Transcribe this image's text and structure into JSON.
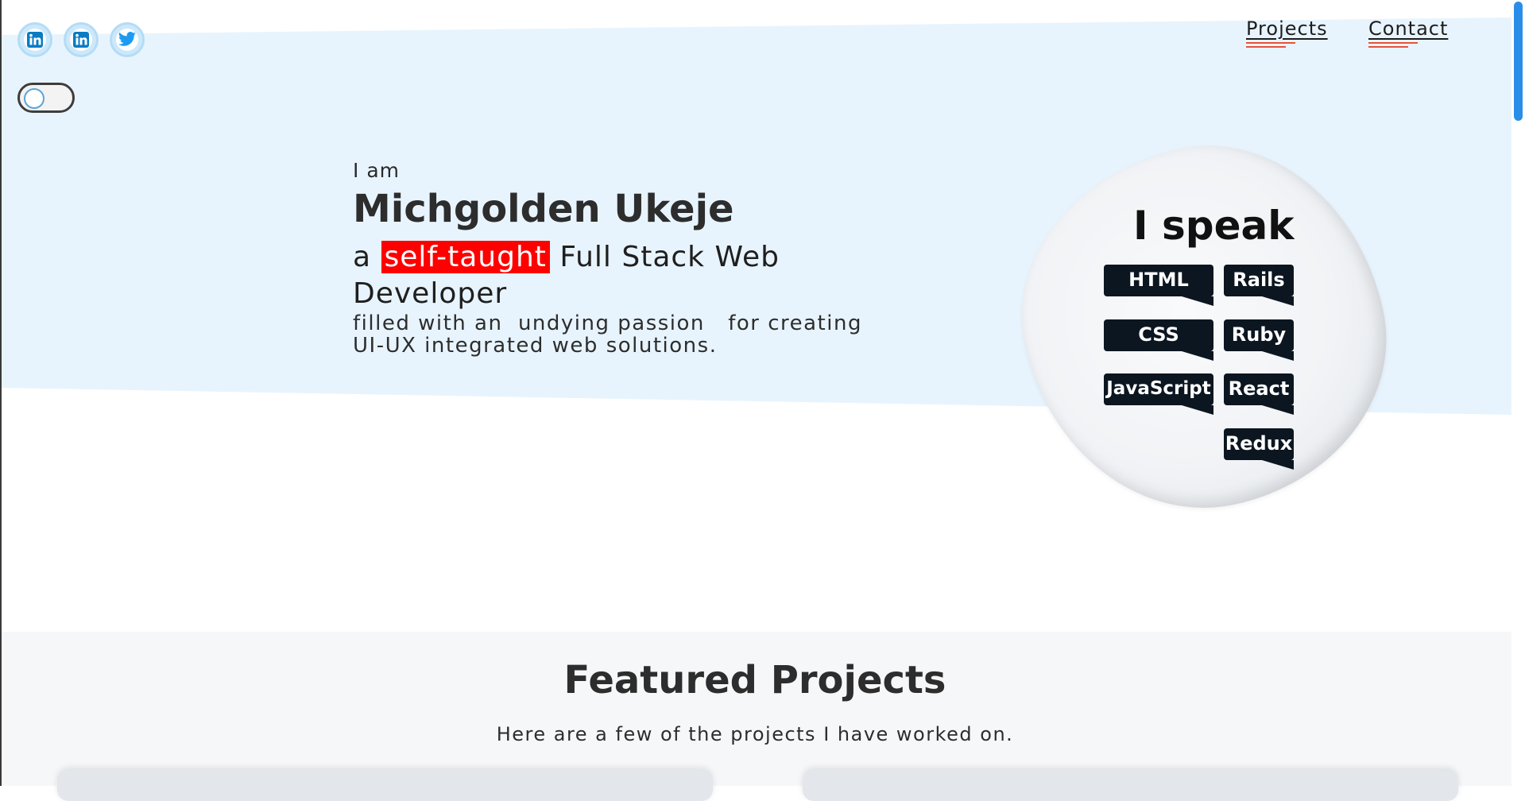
{
  "social": [
    {
      "name": "linkedin-icon",
      "glyph": "in"
    },
    {
      "name": "linkedin-icon",
      "glyph": "in"
    },
    {
      "name": "twitter-icon",
      "glyph": ""
    }
  ],
  "nav": {
    "projects_label": "Projects",
    "contact_label": "Contact"
  },
  "hero": {
    "iam": "I am",
    "name": "Michgolden Ukeje",
    "role_prefix": "a",
    "role_highlight": "self-taught",
    "role_rest": "Full Stack Web Developer",
    "passion_line1": "filled with an  undying passion   for creating",
    "passion_line2": "UI-UX integrated web solutions."
  },
  "skills": {
    "title": "I speak",
    "tags": [
      "HTML",
      "Rails",
      "CSS",
      "Ruby",
      "JavaScript",
      "React",
      "Redux"
    ]
  },
  "projects": {
    "title": "Featured Projects",
    "subtitle": "Here are a few of the projects I have worked on."
  },
  "colors": {
    "hero_band": "#e8f4fd",
    "highlight": "#ff0000",
    "tag_bg": "#0c1620",
    "accent": "#e5533c",
    "social": "#0a7cc4"
  }
}
